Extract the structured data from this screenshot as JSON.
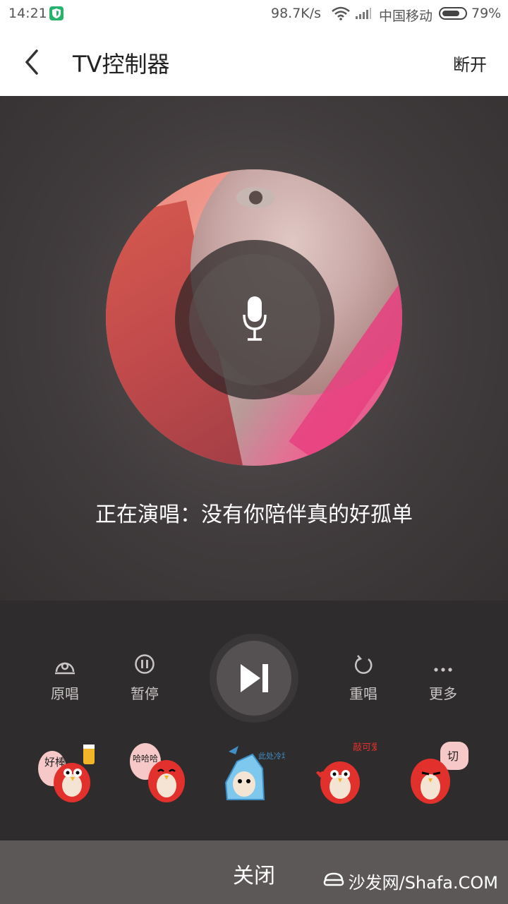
{
  "status_bar": {
    "time": "14:21",
    "net_speed": "98.7K/s",
    "carrier": "中国移动",
    "battery_pct": "79%",
    "battery_level": 0.79
  },
  "header": {
    "title": "TV控制器",
    "disconnect_label": "断开"
  },
  "player": {
    "now_playing": "正在演唱：没有你陪伴真的好孤单"
  },
  "controls": {
    "original_label": "原唱",
    "pause_label": "暂停",
    "replay_label": "重唱",
    "more_label": "更多"
  },
  "stickers": [
    {
      "icon": "sticker-great-icon",
      "text": "好棒"
    },
    {
      "icon": "sticker-haha-icon",
      "text": "哈哈哈"
    },
    {
      "icon": "sticker-cold-icon",
      "text": "此处冷场..."
    },
    {
      "icon": "sticker-cute-icon",
      "text": "敲可爱"
    },
    {
      "icon": "sticker-tsk-icon",
      "text": "切"
    }
  ],
  "footer": {
    "close_label": "关闭",
    "watermark": "沙发网/Shafa.COM"
  },
  "colors": {
    "accent_green": "#27b36b",
    "sticker_red": "#e2312c"
  }
}
